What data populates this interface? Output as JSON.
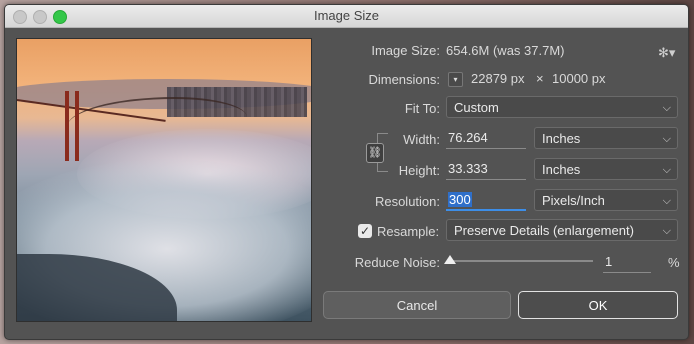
{
  "window": {
    "title": "Image Size"
  },
  "image_size": {
    "label": "Image Size:",
    "value": "654.6M (was 37.7M)"
  },
  "dimensions": {
    "label": "Dimensions:",
    "width": "22879 px",
    "times": "×",
    "height": "10000 px"
  },
  "fit_to": {
    "label": "Fit To:",
    "value": "Custom"
  },
  "width": {
    "label": "Width:",
    "value": "76.264",
    "unit": "Inches"
  },
  "height": {
    "label": "Height:",
    "value": "33.333",
    "unit": "Inches"
  },
  "resolution": {
    "label": "Resolution:",
    "value": "300",
    "unit": "Pixels/Inch"
  },
  "resample": {
    "label": "Resample:",
    "checked": true,
    "value": "Preserve Details (enlargement)"
  },
  "reduce_noise": {
    "label": "Reduce Noise:",
    "value": "1",
    "unit": "%",
    "level_fraction": 0.01
  },
  "buttons": {
    "cancel": "Cancel",
    "ok": "OK"
  }
}
